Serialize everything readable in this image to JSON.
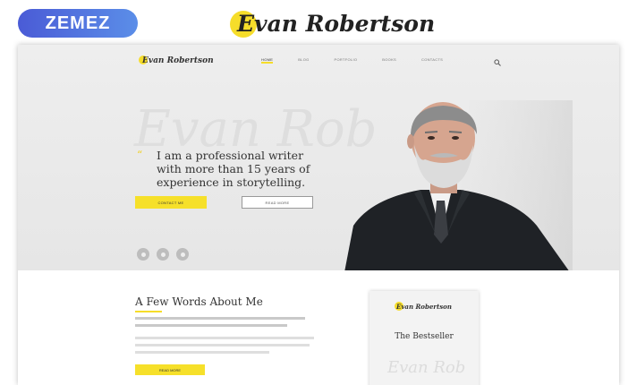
{
  "header": {
    "zemez_logo": "ZEMEZ",
    "brand_title": "Evan Robertson"
  },
  "site": {
    "logo_text": "Evan Robertson",
    "nav": [
      "Home",
      "Blog",
      "Portfolio",
      "Books",
      "Contacts"
    ],
    "hero": {
      "watermark": "Evan Rob",
      "headline_1": "I am a professional writer",
      "headline_2": "with more than 15 years of",
      "headline_3": "experience in storytelling.",
      "contact_button": "Contact Me",
      "read_button": "Read More"
    },
    "about": {
      "title": "A Few Words About Me",
      "more_button": "Read More"
    },
    "book": {
      "logo_text": "Evan Robertson",
      "title": "The Bestseller",
      "script": "Evan Rob"
    }
  },
  "colors": {
    "accent": "#f6dd2a",
    "zemez": "#4a5bd6"
  }
}
